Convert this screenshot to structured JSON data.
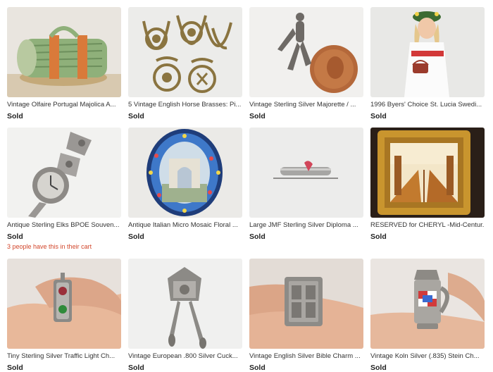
{
  "listings": [
    {
      "title": "Vintage Olfaire Portugal Majolica A...",
      "status": "Sold",
      "image": "majolica-asparagus-dish"
    },
    {
      "title": "5 Vintage English Horse Brasses: Pi...",
      "status": "Sold",
      "image": "horse-brasses"
    },
    {
      "title": "Vintage Sterling Silver Majorette / ...",
      "status": "Sold",
      "image": "majorette-charm-with-penny"
    },
    {
      "title": "1996 Byers' Choice St. Lucia Swedi...",
      "status": "Sold",
      "image": "st-lucia-figurine"
    },
    {
      "title": "Antique Sterling Elks BPOE Souven...",
      "status": "Sold",
      "cart_note": "3 people have this in their cart",
      "image": "elks-spoon"
    },
    {
      "title": "Antique Italian Micro Mosaic Floral ...",
      "status": "Sold",
      "image": "micro-mosaic-frame"
    },
    {
      "title": "Large JMF Sterling Silver Diploma ...",
      "status": "Sold",
      "image": "diploma-pin"
    },
    {
      "title": "RESERVED for CHERYL -Mid-Centur...",
      "status": "Sold",
      "image": "framed-painting"
    },
    {
      "title": "Tiny Sterling Silver Traffic Light Ch...",
      "status": "Sold",
      "image": "traffic-light-charm"
    },
    {
      "title": "Vintage European .800 Silver Cuck...",
      "status": "Sold",
      "image": "cuckoo-clock-charm"
    },
    {
      "title": "Vintage English Silver Bible Charm ...",
      "status": "Sold",
      "image": "bible-charm"
    },
    {
      "title": "Vintage Koln Silver (.835) Stein Ch...",
      "status": "Sold",
      "image": "stein-charm"
    }
  ]
}
